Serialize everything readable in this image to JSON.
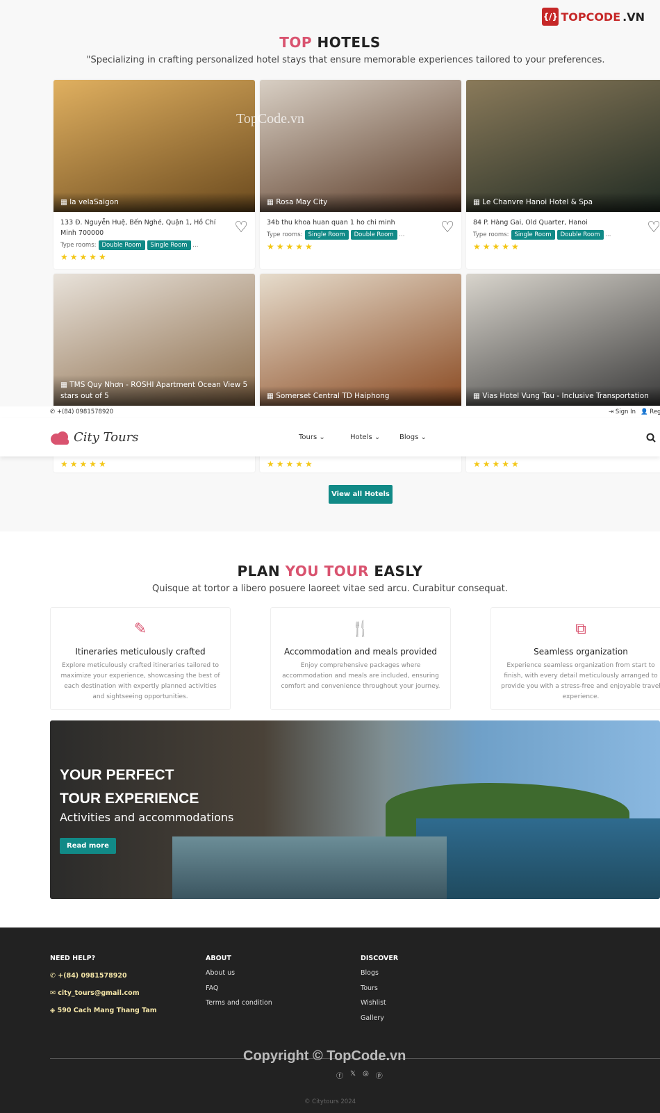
{
  "watermark": {
    "brand": "TOPCODE.VN",
    "image_text": "TopCode.vn",
    "copyright": "Copyright © TopCode.vn"
  },
  "hotels_section": {
    "title_accent": "TOP",
    "title_rest": "HOTELS",
    "subtitle": "\"Specializing in crafting personalized hotel stays that ensure memorable experiences tailored to your preferences.",
    "type_label": "Type rooms:",
    "more": "...",
    "view_all": "View all Hotels"
  },
  "hotels": [
    {
      "name": "la velaSaigon",
      "address": "133 Đ. Nguyễn Huệ, Bến Nghé, Quận 1, Hồ Chí Minh 700000",
      "rooms": [
        "Double Room",
        "Single Room"
      ],
      "rating": 5,
      "colors": [
        "#6b4a1e",
        "#e0b060"
      ]
    },
    {
      "name": "Rosa May City",
      "address": "34b thu khoa huan quan 1 ho chi minh",
      "rooms": [
        "Single Room",
        "Double Room"
      ],
      "rating": 5,
      "colors": [
        "#5a3a26",
        "#d8cfc4"
      ]
    },
    {
      "name": "Le Chanvre Hanoi Hotel & Spa",
      "address": "84 P. Hàng Gai, Old Quarter, Hanoi",
      "rooms": [
        "Single Room",
        "Double Room"
      ],
      "rating": 5,
      "colors": [
        "#1f2a22",
        "#8a7a5a"
      ]
    },
    {
      "name": "TMS Quy Nhơn - ROSHI Apartment Ocean View 5 stars out of 5",
      "rating": 5,
      "colors": [
        "#8a6a48",
        "#e8e2da"
      ]
    },
    {
      "name": "Somerset Central TD Haiphong",
      "rating": 5,
      "colors": [
        "#8a4a22",
        "#e6dccc"
      ]
    },
    {
      "name": "Vias Hotel Vung Tau - Inclusive Transportation",
      "rating": 5,
      "colors": [
        "#3a3a3a",
        "#d8d4cc"
      ]
    }
  ],
  "topbar": {
    "phone": "+(84) 0981578920",
    "sign_in": "Sign In",
    "register": "Regi"
  },
  "header": {
    "logo": "City Tours",
    "nav": [
      "Tours",
      "Hotels",
      "Blogs"
    ]
  },
  "plan": {
    "w1": "PLAN",
    "w2": "YOU TOUR",
    "w3": "EASLY",
    "subtitle": "Quisque at tortor a libero posuere laoreet vitae sed arcu. Curabitur consequat.",
    "features": [
      {
        "icon": "edit-icon",
        "title": "Itineraries meticulously crafted",
        "text": "Explore meticulously crafted itineraries tailored to maximize your experience, showcasing the best of each destination with expertly planned activities and sightseeing opportunities."
      },
      {
        "icon": "utensils-icon",
        "title": "Accommodation and meals provided",
        "text": "Enjoy comprehensive packages where accommodation and meals are included, ensuring comfort and convenience throughout your journey."
      },
      {
        "icon": "sitemap-icon",
        "title": "Seamless organization",
        "text": "Experience seamless organization from start to finish, with every detail meticulously arranged to provide you with a stress-free and enjoyable travel experience."
      }
    ]
  },
  "banner": {
    "line1": "YOUR PERFECT",
    "line2": "TOUR EXPERIENCE",
    "subtitle": "Activities and accommodations",
    "button": "Read more"
  },
  "footer": {
    "help_title": "NEED HELP?",
    "phone": "+(84) 0981578920",
    "email": "city_tours@gmail.com",
    "address": "590 Cach Mang Thang Tam",
    "about_title": "ABOUT",
    "about": [
      "About us",
      "FAQ",
      "Terms and condition"
    ],
    "discover_title": "DISCOVER",
    "discover": [
      "Blogs",
      "Tours",
      "Wishlist",
      "Gallery"
    ],
    "copyright": "© Citytours 2024"
  },
  "colors": {
    "accent": "#d9536f",
    "teal": "#118a87",
    "star": "#f3c614",
    "footer_bg": "#222222"
  }
}
